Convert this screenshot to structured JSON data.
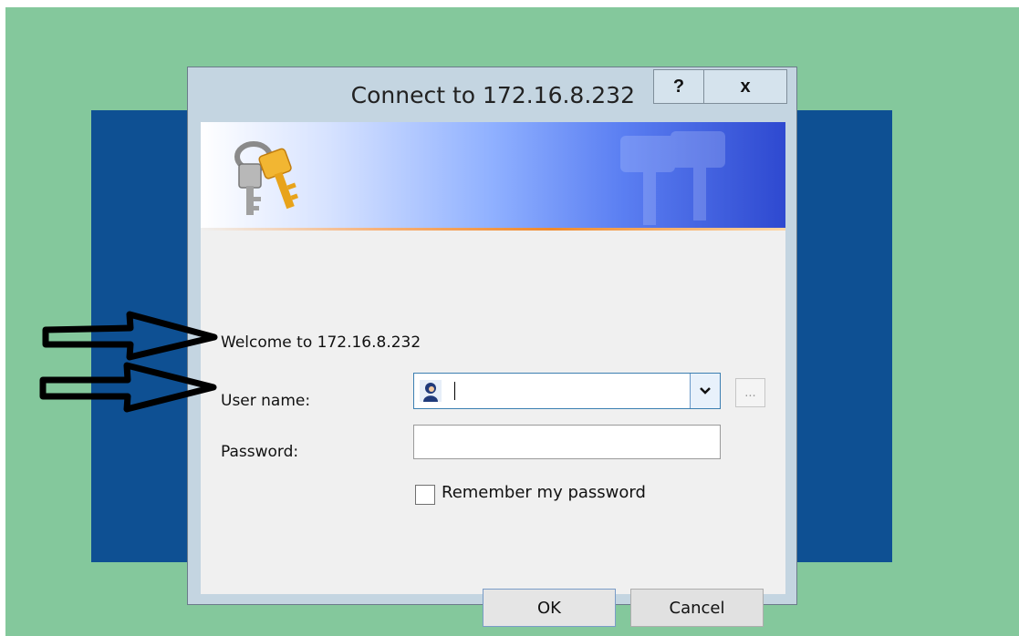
{
  "dialog": {
    "title": "Connect to 172.16.8.232",
    "help_label": "?",
    "close_label": "x"
  },
  "form": {
    "welcome": "Welcome to 172.16.8.232",
    "user_label": "User name:",
    "password_label": "Password:",
    "user_value": "",
    "password_value": "",
    "browse_label": "...",
    "remember_label": "Remember my password",
    "remember_checked": false
  },
  "buttons": {
    "ok": "OK",
    "cancel": "Cancel"
  },
  "icons": {
    "banner": "keys-icon",
    "user": "user-icon",
    "dropdown": "chevron-down-icon"
  },
  "annotations": {
    "arrows": [
      "arrow-to-user-name",
      "arrow-to-password"
    ]
  },
  "colors": {
    "background": "#84c89c",
    "desktop": "#0e5093",
    "dialog_frame": "#c4d5e1"
  }
}
